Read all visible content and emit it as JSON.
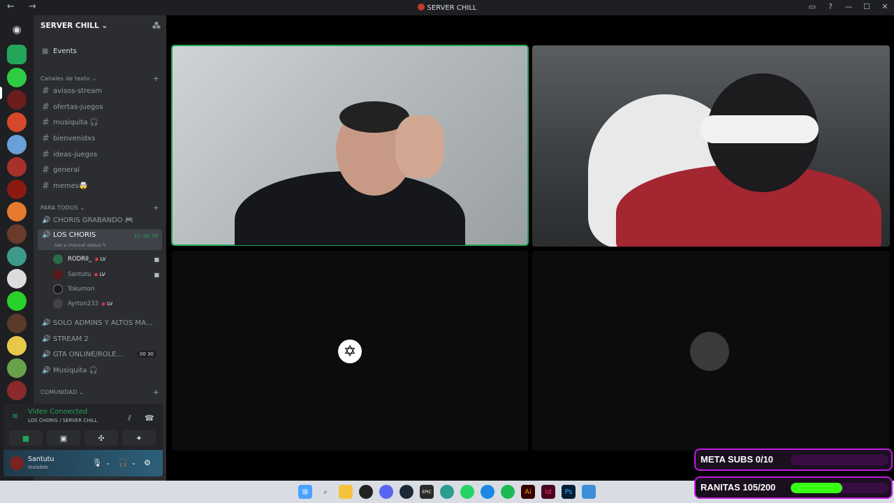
{
  "window": {
    "title": "SERVER CHILL",
    "nav": "← →",
    "controls": [
      "▭",
      "?",
      "—",
      "☐",
      "✕"
    ]
  },
  "server": {
    "name": "SERVER CHILL ⌄",
    "events_label": "Events"
  },
  "categories": {
    "text": "Canales de texto ⌄",
    "para_todos": "PARA TODOS ⌄",
    "comunidad": "COMUNIDAD ⌄"
  },
  "text_channels": [
    "avisos-stream",
    "ofertas-juegos",
    "musiquita 🎧",
    "bienvenidxs",
    "ideas-juegos",
    "general",
    "memes🤯"
  ],
  "voice_channels": {
    "grabando": "CHORIS GRABANDO 🎮",
    "active": {
      "name": "LOS CHORIS",
      "status": "Set a channel status ✎",
      "timer": "11:50:59"
    },
    "others": [
      {
        "name": "SOLO ADMINS Y ALTOS MA...",
        "badge": ""
      },
      {
        "name": "STREAM 2",
        "badge": ""
      },
      {
        "name": "GTA ONLINE/ROLE...",
        "badge": "00  30"
      },
      {
        "name": "Musiquita 🎧",
        "badge": ""
      }
    ]
  },
  "members": [
    {
      "name": "RODRII_",
      "tag": "LV",
      "camera": true
    },
    {
      "name": "Santutu",
      "tag": "LV",
      "camera": true
    },
    {
      "name": "Tokumori",
      "tag": "",
      "camera": false
    },
    {
      "name": "Ayrton233",
      "tag": "LV",
      "camera": false
    }
  ],
  "voice_panel": {
    "status": "Video Connected",
    "location": "LOS CHORIS / SERVER CHILL"
  },
  "user": {
    "name": "Santutu",
    "status": "Invisible"
  },
  "overlays": {
    "meta_subs": {
      "label": "META SUBS 0/10",
      "progress": 0.0
    },
    "ranitas": {
      "label": "RANITAS 105/200",
      "progress": 0.525
    }
  },
  "colors": {
    "accent_green": "#23a55a",
    "overlay_border": "#c01be0",
    "overlay_fill": "#39ff14"
  },
  "icons": {
    "taskbar": [
      "windows-start-icon",
      "search-icon",
      "file-explorer-icon",
      "chrome-icon",
      "discord-icon",
      "steam-icon",
      "epic-games-icon",
      "edge-icon",
      "whatsapp-icon",
      "photos-icon",
      "spotify-icon",
      "illustrator-icon",
      "indesign-icon",
      "photoshop-icon",
      "app-icon"
    ]
  }
}
